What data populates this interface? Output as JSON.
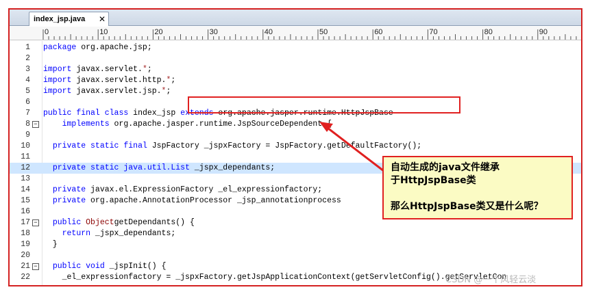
{
  "tab": {
    "title": "index_jsp.java",
    "close": "✕"
  },
  "ruler": {
    "marks": [
      "0",
      "10",
      "20",
      "30",
      "40",
      "50",
      "60",
      "70",
      "80",
      "90"
    ]
  },
  "lines": [
    {
      "n": "1",
      "tokens": [
        [
          "kw",
          "package"
        ],
        [
          "",
          "org.apache.jsp;"
        ]
      ]
    },
    {
      "n": "2",
      "tokens": []
    },
    {
      "n": "3",
      "tokens": [
        [
          "kw",
          "import"
        ],
        [
          "",
          "javax.servlet."
        ],
        [
          "op",
          "*"
        ],
        [
          "",
          ";"
        ]
      ]
    },
    {
      "n": "4",
      "tokens": [
        [
          "kw",
          "import"
        ],
        [
          "",
          "javax.servlet.http."
        ],
        [
          "op",
          "*"
        ],
        [
          "",
          ";"
        ]
      ]
    },
    {
      "n": "5",
      "tokens": [
        [
          "kw",
          "import"
        ],
        [
          "",
          "javax.servlet.jsp."
        ],
        [
          "op",
          "*"
        ],
        [
          "",
          ";"
        ]
      ]
    },
    {
      "n": "6",
      "tokens": []
    },
    {
      "n": "7",
      "tokens": [
        [
          "kw",
          "public"
        ],
        [
          "",
          "&nbsp;"
        ],
        [
          "kw",
          "final"
        ],
        [
          "",
          "&nbsp;"
        ],
        [
          "kw",
          "class"
        ],
        [
          "",
          "index_jsp"
        ],
        [
          "",
          "&nbsp;"
        ],
        [
          "kw",
          "extends"
        ],
        [
          "",
          "&nbsp;org.apache.jasper.runtime.HttpJspBase"
        ]
      ]
    },
    {
      "n": "8",
      "tokens": [
        [
          "",
          "    "
        ],
        [
          "kw",
          "implements"
        ],
        [
          "",
          "org.apache.jasper.runtime.JspSourceDependent {"
        ]
      ],
      "fold": "−"
    },
    {
      "n": "9",
      "tokens": []
    },
    {
      "n": "10",
      "tokens": [
        [
          "",
          "  "
        ],
        [
          "kw",
          "private"
        ],
        [
          "",
          "&nbsp;"
        ],
        [
          "kw",
          "static"
        ],
        [
          "",
          "&nbsp;"
        ],
        [
          "kw",
          "final"
        ],
        [
          "",
          "JspFactory _jspxFactory = JspFactory.getDefaultFactory();"
        ]
      ]
    },
    {
      "n": "11",
      "tokens": []
    },
    {
      "n": "12",
      "tokens": [
        [
          "",
          "  "
        ],
        [
          "kw",
          "private"
        ],
        [
          "",
          "&nbsp;"
        ],
        [
          "kw",
          "static"
        ],
        [
          "",
          "&nbsp;"
        ],
        [
          "kw",
          "java.util.List"
        ],
        [
          "",
          "_jspx_dependants;"
        ]
      ],
      "current": true
    },
    {
      "n": "13",
      "tokens": []
    },
    {
      "n": "14",
      "tokens": [
        [
          "",
          "  "
        ],
        [
          "kw",
          "private"
        ],
        [
          "",
          "javax.el.ExpressionFactory _el_expressionfactory;"
        ]
      ]
    },
    {
      "n": "15",
      "tokens": [
        [
          "",
          "  "
        ],
        [
          "kw",
          "private"
        ],
        [
          "",
          "org.apache.AnnotationProcessor _jsp_annotationprocess"
        ]
      ]
    },
    {
      "n": "16",
      "tokens": []
    },
    {
      "n": "17",
      "tokens": [
        [
          "",
          "  "
        ],
        [
          "kw",
          "public"
        ],
        [
          "",
          "&nbsp;"
        ],
        [
          "ty",
          "Object"
        ],
        [
          "",
          "getDependants() {"
        ]
      ],
      "fold": "−"
    },
    {
      "n": "18",
      "tokens": [
        [
          "",
          "    "
        ],
        [
          "kw",
          "return"
        ],
        [
          "",
          "_jspx_dependants;"
        ]
      ]
    },
    {
      "n": "19",
      "tokens": [
        [
          "",
          "  }"
        ]
      ]
    },
    {
      "n": "20",
      "tokens": []
    },
    {
      "n": "21",
      "tokens": [
        [
          "",
          "  "
        ],
        [
          "kw",
          "public"
        ],
        [
          "",
          "&nbsp;"
        ],
        [
          "kw",
          "void"
        ],
        [
          "",
          "_jspInit() {"
        ]
      ],
      "fold": "−"
    },
    {
      "n": "22",
      "tokens": [
        [
          "",
          "    _el_expressionfactory = _jspxFactory.getJspApplicationContext(getServletConfig().getServletCon"
        ]
      ]
    }
  ],
  "callout": {
    "line1": "自动生成的java文件继承",
    "line2": "于HttpJspBase类",
    "line3": "那么HttpJspBase类又是什么呢？"
  },
  "watermark": "CSDN @一个风轻云淡",
  "colors": {
    "frame": "#d42020",
    "keyword": "#0000ff",
    "current_line": "#cfe6ff",
    "callout_bg": "#fbfbc4"
  }
}
